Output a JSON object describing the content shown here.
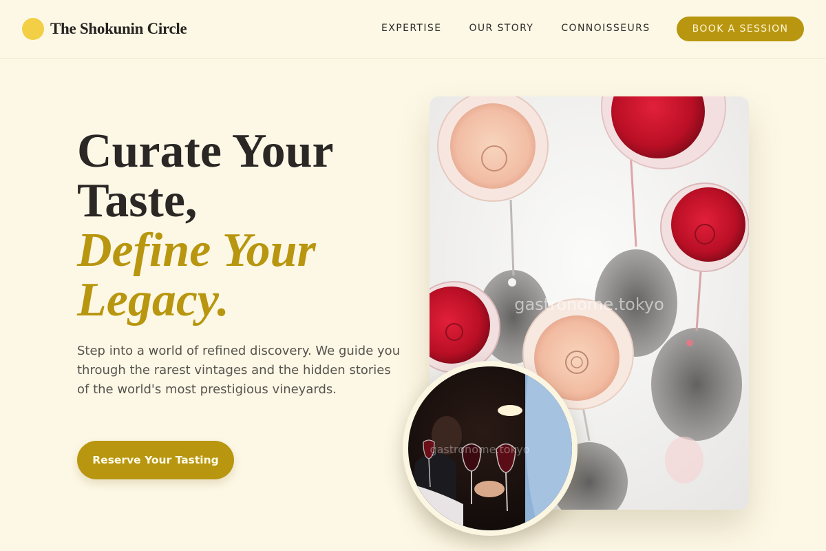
{
  "brand": {
    "name": "The Shokunin Circle"
  },
  "nav": {
    "items": [
      {
        "label": "EXPERTISE"
      },
      {
        "label": "OUR STORY"
      },
      {
        "label": "CONNOISSEURS"
      }
    ],
    "cta_label": "BOOK A SESSION"
  },
  "hero": {
    "title_line1": "Curate Your",
    "title_line2": "Taste,",
    "title_line3": "Define Your",
    "title_line4": "Legacy.",
    "description": "Step into a world of refined discovery. We guide you through the rarest vintages and the hidden stories of the world's most prestigious vineyards.",
    "cta_label": "Reserve Your Tasting"
  },
  "images": {
    "main_watermark": "gastronome.tokyo",
    "round_watermark": "gastronome.tokyo"
  },
  "colors": {
    "background": "#fdf8e6",
    "accent_gold": "#b8960f",
    "brand_dot": "#f3cf45",
    "text_dark": "#2a2725",
    "text_muted": "#57534d"
  }
}
